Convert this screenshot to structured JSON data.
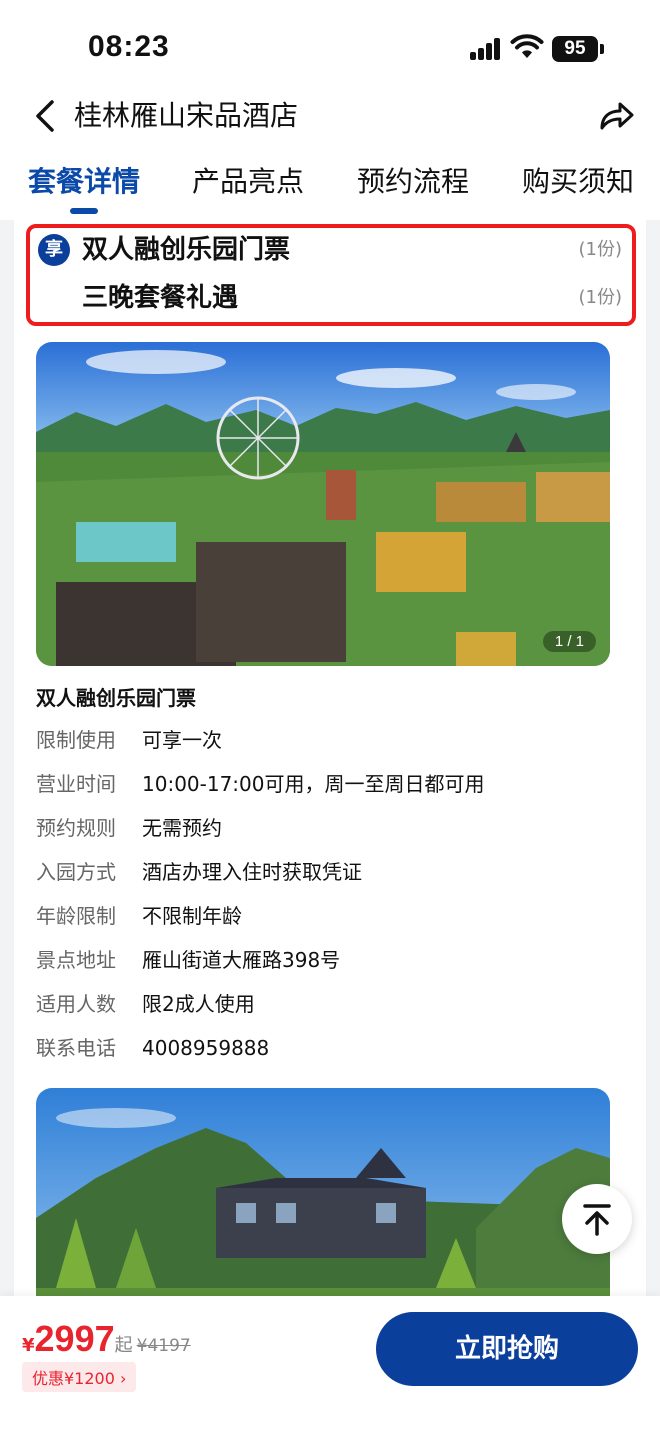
{
  "status_bar": {
    "time": "08:23",
    "battery": "95"
  },
  "header": {
    "title": "桂林雁山宋品酒店"
  },
  "tabs": [
    {
      "label": "套餐详情"
    },
    {
      "label": "产品亮点"
    },
    {
      "label": "预约流程"
    },
    {
      "label": "购买须知"
    }
  ],
  "benefits": {
    "badge": "享",
    "items": [
      {
        "name": "双人融创乐园门票",
        "qty": "(1份)"
      },
      {
        "name": "三晚套餐礼遇",
        "qty": "(1份)"
      }
    ]
  },
  "gallery": {
    "counter": "1 / 1"
  },
  "ticket": {
    "title": "双人融创乐园门票",
    "rows": [
      {
        "label": "限制使用",
        "value": "可享一次"
      },
      {
        "label": "营业时间",
        "value": "10:00-17:00可用，周一至周日都可用"
      },
      {
        "label": "预约规则",
        "value": "无需预约"
      },
      {
        "label": "入园方式",
        "value": "酒店办理入住时获取凭证"
      },
      {
        "label": "年龄限制",
        "value": "不限制年龄"
      },
      {
        "label": "景点地址",
        "value": "雁山街道大雁路398号"
      },
      {
        "label": "适用人数",
        "value": "限2成人使用"
      },
      {
        "label": "联系电话",
        "value": "4008959888"
      }
    ]
  },
  "bottom_bar": {
    "currency": "¥",
    "price": "2997",
    "price_suffix": "起",
    "original_price": "¥4197",
    "discount": "优惠¥1200 ›",
    "buy_label": "立即抢购"
  },
  "colors": {
    "brand_blue": "#0b3f9c",
    "price_red": "#e8242e",
    "highlight_red": "#ee1c1c"
  }
}
